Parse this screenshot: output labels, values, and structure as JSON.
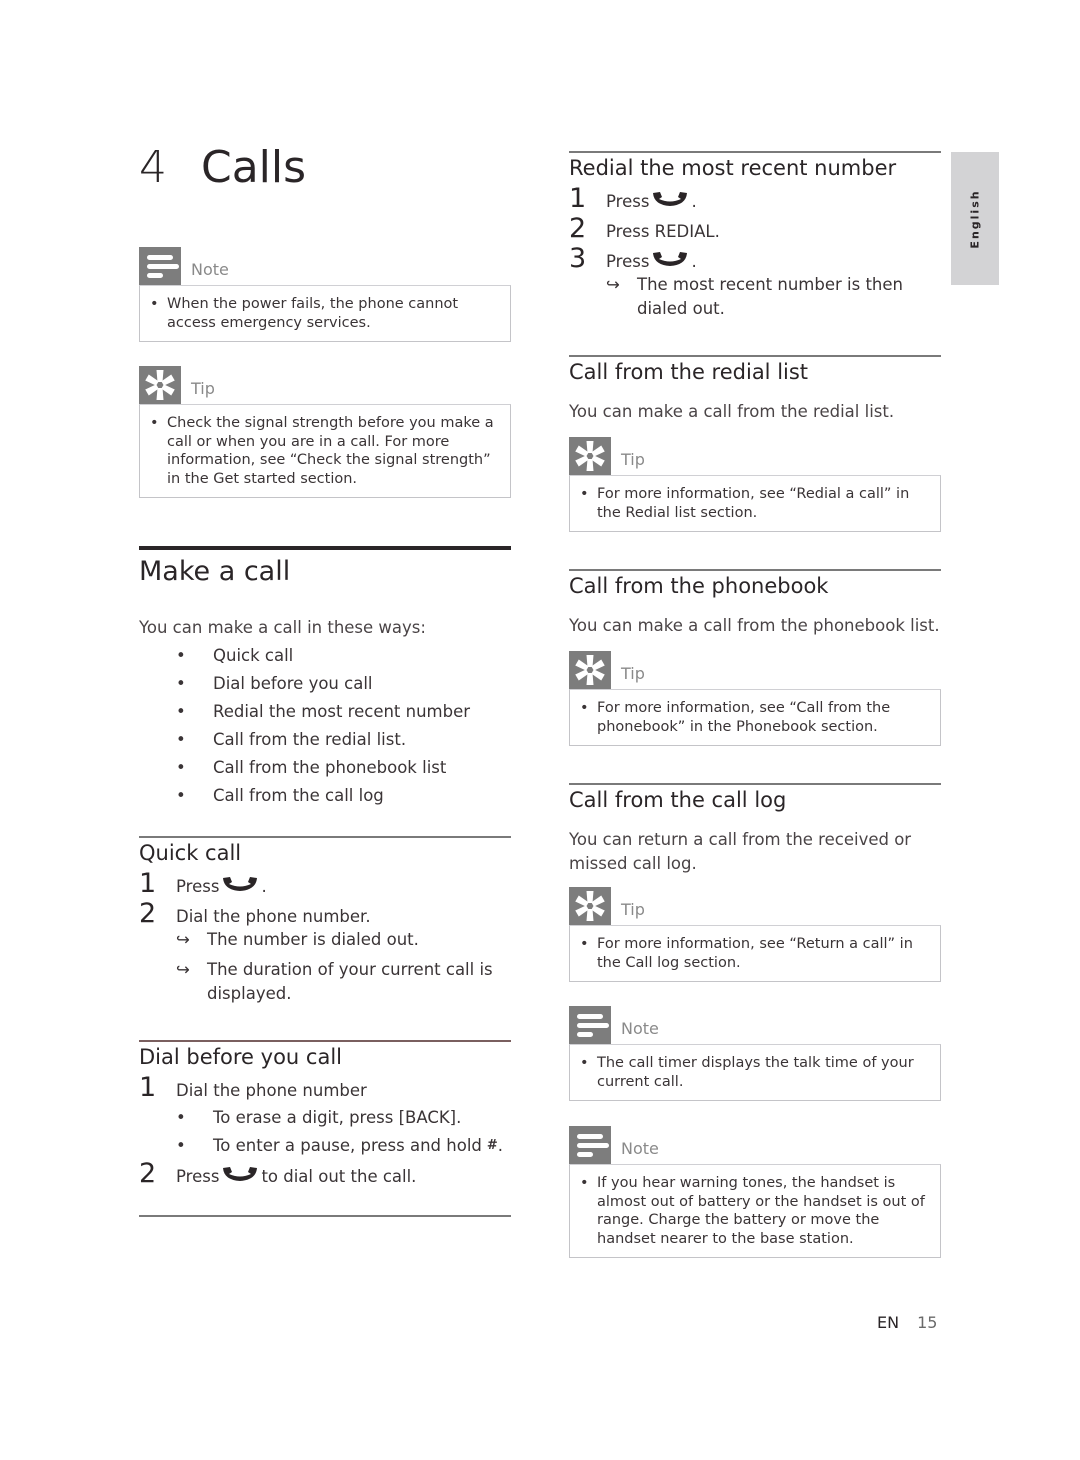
{
  "chapter": {
    "number": "4",
    "title": "Calls"
  },
  "language_tab": "English",
  "footer": {
    "lang": "EN",
    "page": "15"
  },
  "left": {
    "note1": {
      "label": "Note",
      "icon": "note-icon",
      "text": "When the power fails, the phone cannot access emergency services."
    },
    "tip1": {
      "label": "Tip",
      "icon": "tip-icon",
      "text": "Check the signal strength before you make a call or when you are in a call. For more information, see “Check the signal strength” in the Get started section."
    },
    "make_call": {
      "title": "Make a call",
      "intro": "You can make a call in these ways:",
      "ways": [
        "Quick call",
        "Dial before you call",
        "Redial the most recent number",
        "Call from the redial list.",
        "Call from the phonebook list",
        "Call from the call log"
      ]
    },
    "quick_call": {
      "title": "Quick call",
      "steps": [
        {
          "num": "1",
          "before": "Press",
          "icon": "talk-key-icon",
          "after": "."
        },
        {
          "num": "2",
          "text": "Dial the phone number."
        }
      ],
      "results": [
        "The number is dialed out.",
        "The duration of your current call is displayed."
      ]
    },
    "dial_before": {
      "title": "Dial before you call",
      "step1": {
        "num": "1",
        "text": "Dial the phone number"
      },
      "bullets": [
        "To erase a digit, press [BACK].",
        "To enter a pause, press and hold"
      ],
      "pause_key_suffix": ".",
      "step2": {
        "num": "2",
        "before": "Press",
        "icon": "talk-key-icon",
        "after": "to dial out the call."
      }
    }
  },
  "right": {
    "redial": {
      "title": "Redial the most recent number",
      "steps": [
        {
          "num": "1",
          "before": "Press",
          "after": "."
        },
        {
          "num": "2",
          "text": "Press REDIAL."
        },
        {
          "num": "3",
          "before": "Press",
          "after": "."
        }
      ],
      "result": "The most recent number is then dialed out."
    },
    "redial_list": {
      "title": "Call from the redial list",
      "intro": "You can make a call from the redial list.",
      "tip": {
        "label": "Tip",
        "text": "For more information, see “Redial a call” in the Redial list section."
      }
    },
    "phonebook": {
      "title": "Call from the phonebook",
      "intro": "You can make a call from the phonebook list.",
      "tip": {
        "label": "Tip",
        "text": "For more information, see “Call from the phonebook” in the Phonebook section."
      }
    },
    "call_log": {
      "title": "Call from the call log",
      "intro": "You can return a call from the received or missed call log.",
      "tip": {
        "label": "Tip",
        "text": "For more information, see “Return a call” in the Call log section."
      }
    },
    "note2": {
      "label": "Note",
      "text": "The call timer displays the talk time of your current call."
    },
    "note3": {
      "label": "Note",
      "text": "If you hear warning tones, the handset is almost out of battery or the handset is out of range. Charge the battery or move the handset nearer to the base station."
    }
  },
  "colors": {
    "icon_box": "#7d7d7d",
    "tab_bg": "#d3d3d5",
    "text": "#2a2527"
  }
}
